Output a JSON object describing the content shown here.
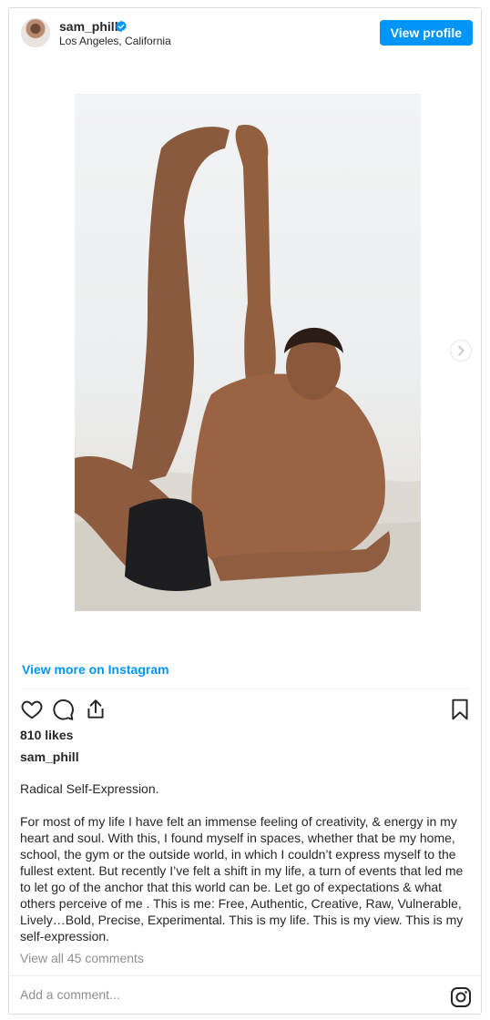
{
  "header": {
    "username": "sam_phill",
    "location": "Los Angeles, California",
    "view_profile_label": "View profile",
    "verified_icon": "verified-badge-icon"
  },
  "media": {
    "description_icon": "post-photo",
    "next_icon": "chevron-right-icon"
  },
  "links": {
    "view_more": "View more on Instagram"
  },
  "actions": {
    "icons": [
      "heart-icon",
      "comment-icon",
      "share-icon",
      "bookmark-icon"
    ]
  },
  "post": {
    "likes": "810 likes",
    "caption_username": "sam_phill",
    "caption": "Radical Self-Expression.\n\nFor most of my life I have felt an immense feeling of creativity, & energy in my heart and soul. With this, I found myself in spaces, whether that be my home, school, the gym or the outside world, in which I couldn’t express myself to the fullest extent. But recently I’ve felt a shift in my life, a turn of events that led me to let go of the anchor that this world can be. Let go of expectations & what others perceive of me . This is me: Free, Authentic, Creative, Raw, Vulnerable, Lively…Bold, Precise, Experimental. This is my life. This is my view. This is my self-expression.",
    "view_comments": "View all 45 comments",
    "add_comment_placeholder": "Add a comment..."
  },
  "colors": {
    "accent": "#0095f6",
    "text": "#262626",
    "muted": "#8e8e8e",
    "border": "#dbdbdb"
  }
}
